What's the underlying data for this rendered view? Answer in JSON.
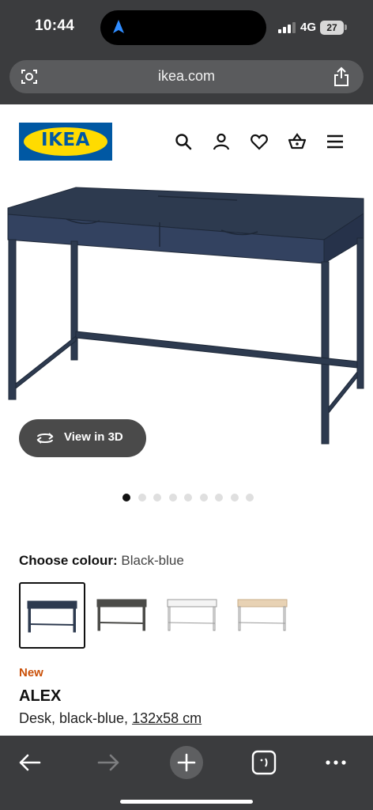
{
  "status_bar": {
    "time": "10:44",
    "network": "4G",
    "battery": "27"
  },
  "browser": {
    "url": "ikea.com"
  },
  "site": {
    "logo_text": "IKEA",
    "brand_blue": "#0058a3",
    "brand_yellow": "#ffdb00"
  },
  "header_icons": [
    "search-icon",
    "account-icon",
    "heart-icon",
    "basket-icon",
    "menu-icon"
  ],
  "product": {
    "view_3d_label": "View in 3D",
    "image_count": 9,
    "active_image": 1,
    "colour_label": "Choose colour:",
    "colour_value": "Black-blue",
    "badge": "New",
    "name": "ALEX",
    "description": "Desk, black-blue,",
    "size_link": "132x58 cm",
    "swatch_colours": [
      "#2d3a4f",
      "#4b4b48",
      "#f4f4f4",
      "#e8d2b4"
    ]
  },
  "toolbar": [
    "back-icon",
    "forward-icon",
    "new-tab-icon",
    "tabs-icon",
    "more-icon"
  ]
}
